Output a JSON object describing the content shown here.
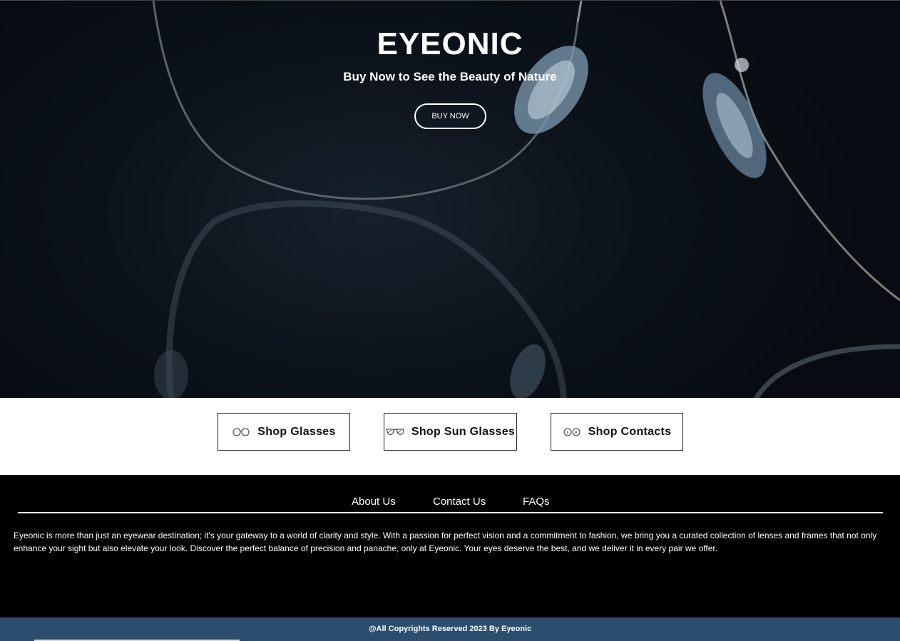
{
  "hero": {
    "title": "EYEONIC",
    "subtitle": "Buy Now to See the Beauty of Nature",
    "button_label": "BUY NOW"
  },
  "shop": {
    "items": [
      {
        "label": "Shop Glasses",
        "icon": "eyeglasses-icon"
      },
      {
        "label": "Shop Sun Glasses",
        "icon": "sunglasses-icon"
      },
      {
        "label": "Shop Contacts",
        "icon": "contact-lens-icon"
      }
    ]
  },
  "footer": {
    "nav": [
      "About Us",
      "Contact Us",
      "FAQs"
    ],
    "about_text": "Eyeonic is more than just an eyewear destination; it's your gateway to a world of clarity and style. With a passion for perfect vision and a commitment to fashion, we bring you a curated collection of lenses and frames that not only enhance your sight but also elevate your look. Discover the perfect balance of precision and panache, only at Eyeonic. Your eyes deserve the best, and we deliver it in every pair we offer.",
    "copyright": "@All Copyrights Reserved 2023 By Eyeonic"
  },
  "colors": {
    "hero_bg": "#0c121a",
    "footer_bg": "#000000",
    "copyright_bg": "#2b4e6e",
    "text_light": "#ffffff"
  }
}
